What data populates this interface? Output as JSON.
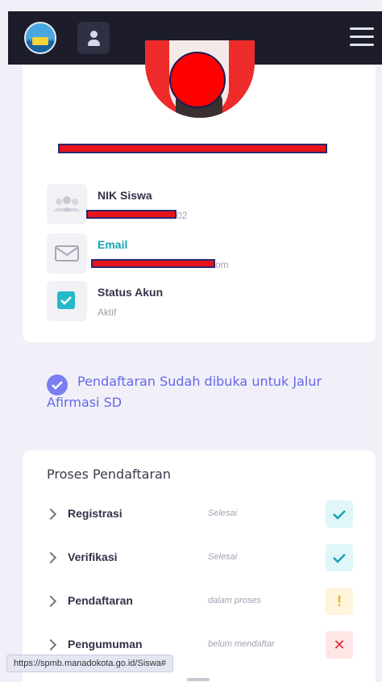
{
  "header": {
    "logo_icon": "school-emblem",
    "user_icon": "user-icon",
    "menu_icon": "hamburger-menu-icon"
  },
  "profile": {
    "fields": [
      {
        "label": "NIK Siswa",
        "value_suffix": "02",
        "icon": "users-icon"
      },
      {
        "label": "Email",
        "value_suffix": "om",
        "icon": "mail-icon"
      },
      {
        "label": "Status Akun",
        "value": "Aktif",
        "icon": "check-icon"
      }
    ]
  },
  "notice": {
    "text": "Pendaftaran Sudah dibuka untuk Jalur Afirmasi SD"
  },
  "process": {
    "title": "Proses Pendaftaran",
    "steps": [
      {
        "name": "Registrasi",
        "status": "Selesai",
        "badge": "check"
      },
      {
        "name": "Verifikasi",
        "status": "Selesai",
        "badge": "check"
      },
      {
        "name": "Pendaftaran",
        "status": "dalam proses",
        "badge": "!"
      },
      {
        "name": "Pengumuman",
        "status": "belum mendaftar",
        "badge": "✕"
      }
    ]
  },
  "status_bar": {
    "url": "https://spmb.manadokota.go.id/Siswa#"
  },
  "colors": {
    "accent": "#14a4b5",
    "notice": "#6468e8",
    "topbar": "#1c1c2a"
  }
}
